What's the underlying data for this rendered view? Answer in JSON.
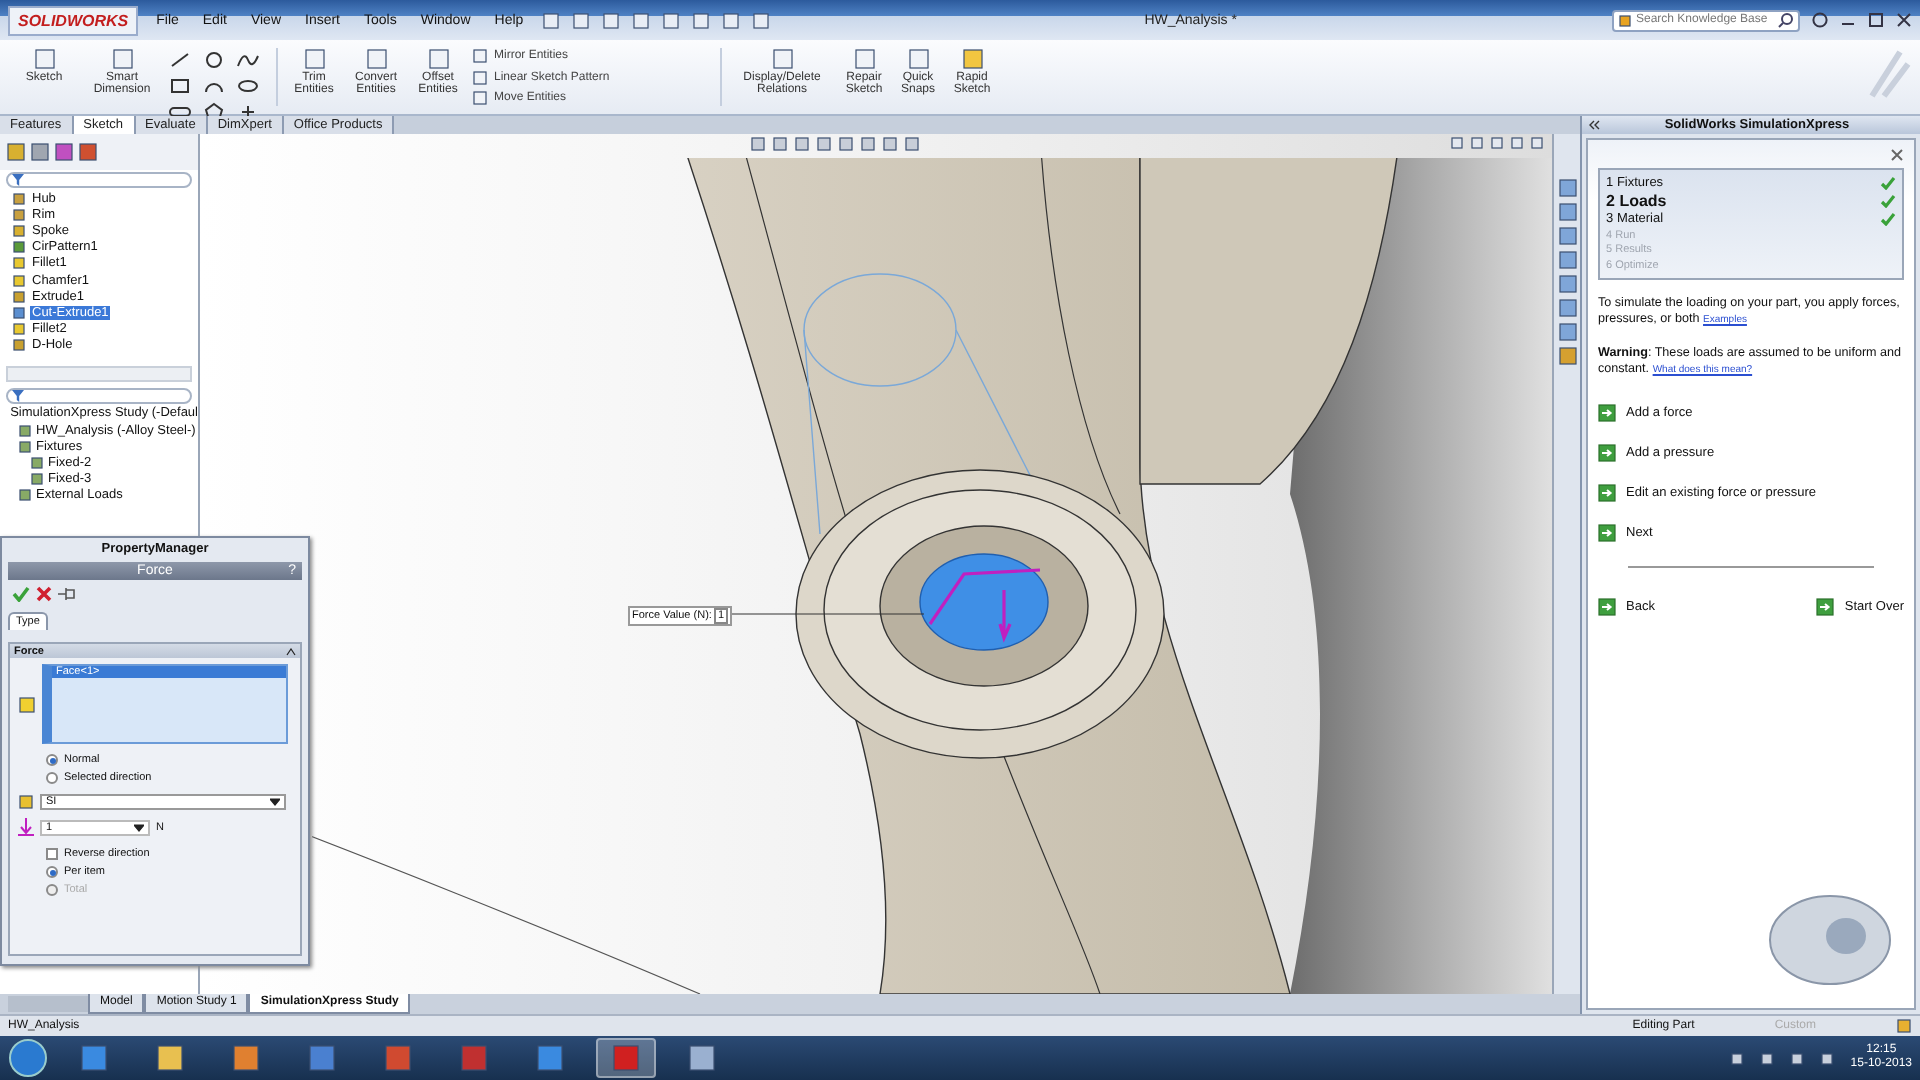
{
  "window": {
    "logo": "SOLIDWORKS",
    "title": "HW_Analysis *"
  },
  "menu": [
    "File",
    "Edit",
    "View",
    "Insert",
    "Tools",
    "Window",
    "Help"
  ],
  "search": {
    "placeholder": "Search Knowledge Base"
  },
  "ribbon": {
    "left": [
      "Sketch",
      "Smart Dimension"
    ],
    "middle": [
      "Trim Entities",
      "Convert Entities",
      "Offset Entities"
    ],
    "stack": [
      "Mirror Entities",
      "Linear Sketch Pattern",
      "Move Entities"
    ],
    "right": [
      "Display/Delete Relations",
      "Repair Sketch",
      "Quick Snaps",
      "Rapid Sketch"
    ]
  },
  "command_tabs": [
    {
      "label": "Features",
      "selected": false
    },
    {
      "label": "Sketch",
      "selected": true
    },
    {
      "label": "Evaluate",
      "selected": false
    },
    {
      "label": "DimXpert",
      "selected": false
    },
    {
      "label": "Office Products",
      "selected": false
    }
  ],
  "feature_tree": [
    {
      "label": "Hub",
      "selected": false
    },
    {
      "label": "Rim",
      "selected": false
    },
    {
      "label": "Spoke",
      "selected": false
    },
    {
      "label": "CirPattern1",
      "selected": false
    },
    {
      "label": "Fillet1",
      "selected": false
    },
    {
      "label": "Chamfer1",
      "selected": false
    },
    {
      "label": "Extrude1",
      "selected": false
    },
    {
      "label": "Cut-Extrude1",
      "selected": true
    },
    {
      "label": "Fillet2",
      "selected": false
    },
    {
      "label": "D-Hole",
      "selected": false
    }
  ],
  "study_tree": {
    "label": "SimulationXpress Study (-Defaul",
    "children": [
      {
        "label": "HW_Analysis (-Alloy Steel-)"
      },
      {
        "label": "Fixtures",
        "children": [
          {
            "label": "Fixed-2"
          },
          {
            "label": "Fixed-3"
          }
        ]
      },
      {
        "label": "External Loads"
      }
    ]
  },
  "property_manager": {
    "title": "PropertyManager",
    "header": "Force",
    "help": "?",
    "tab": "Type",
    "group": "Force",
    "selection": "Face<1>",
    "direction": [
      {
        "label": "Normal",
        "selected": true
      },
      {
        "label": "Selected direction",
        "selected": false
      }
    ],
    "units": "SI",
    "value": "1",
    "value_unit": "N",
    "reverse": {
      "label": "Reverse direction",
      "checked": false
    },
    "distribution": [
      {
        "label": "Per item",
        "selected": true,
        "disabled": false
      },
      {
        "label": "Total",
        "selected": false,
        "disabled": true
      }
    ]
  },
  "viewport": {
    "callout": "Force Value (N):",
    "callout_value": "1"
  },
  "task_pane": {
    "title": "SolidWorks SimulationXpress",
    "steps": [
      {
        "number": "1",
        "label": "Fixtures",
        "checked": true,
        "selected": false,
        "disabled": false
      },
      {
        "number": "2",
        "label": "Loads",
        "checked": true,
        "selected": true,
        "disabled": false
      },
      {
        "number": "3",
        "label": "Material",
        "checked": true,
        "selected": false,
        "disabled": false
      },
      {
        "number": "4",
        "label": "Run",
        "checked": false,
        "selected": false,
        "disabled": true
      },
      {
        "number": "5",
        "label": "Results",
        "checked": false,
        "selected": false,
        "disabled": true
      },
      {
        "number": "6",
        "label": "Optimize",
        "checked": false,
        "selected": false,
        "disabled": true
      }
    ],
    "intro": "To simulate the loading on your part, you apply forces, pressures, or both",
    "intro_link": "Examples",
    "warning": "**Warning**: These loads are assumed to be uniform and constant.",
    "warning_link": "What does this mean?",
    "actions": [
      "Add a force",
      "Add a pressure",
      "Edit an existing force or pressure",
      "Next"
    ],
    "back": "Back",
    "start_over": "Start Over"
  },
  "bottom_tabs": [
    {
      "label": "Model",
      "selected": false
    },
    {
      "label": "Motion Study 1",
      "selected": false
    },
    {
      "label": "SimulationXpress Study",
      "selected": true
    }
  ],
  "status_bar": {
    "file": "HW_Analysis",
    "mode": "Editing Part",
    "units": "Custom"
  },
  "taskbar": {
    "time": "12:15",
    "date": "15-10-2013"
  }
}
